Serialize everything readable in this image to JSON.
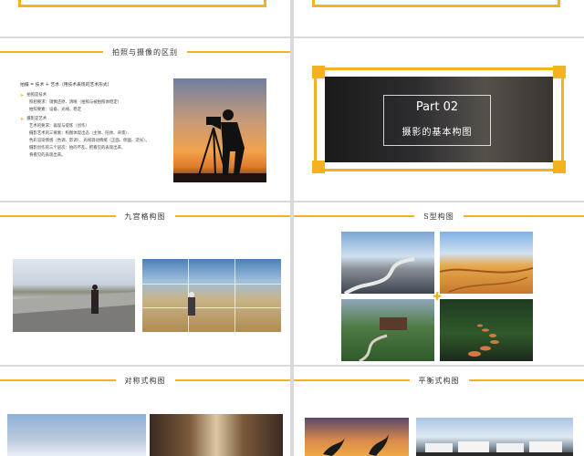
{
  "slides": {
    "distinction": {
      "title": "拍照与摄像的区别",
      "formula": "拍摄 = 技术 + 艺术（用技术表现的艺术形式）",
      "sections": [
        {
          "heading": "拍照是技术",
          "lines": [
            "照相要求：镜像还原、清晰（拍照与被拍照体稳定）",
            "拍照要素：设备、光线、稳定"
          ]
        },
        {
          "heading": "摄影是艺术",
          "lines": [
            "艺术的要求：再现与提炼（创作）",
            "摄影艺术的三要素：构图体现出态（主体、陪体、背景）、",
            "色彩渲染情感（色调、影调）、光线调动情绪（正面、侧面、逆光）。",
            "摄影创作的三个层次：拍的不乱、把看见的表现出来、",
            "将看见的表现出来。"
          ]
        }
      ]
    },
    "part": {
      "label": "Part 02",
      "subtitle": "摄影的基本构图"
    },
    "nine_grid": {
      "title": "九宫格构图"
    },
    "s_curve": {
      "title": "S型构图"
    },
    "symmetric": {
      "title": "对称式构图"
    },
    "balanced": {
      "title": "平衡式构图"
    }
  },
  "colors": {
    "accent": "#f5b21f",
    "slide_bg": "#ffffff",
    "page_bg": "#d9d9d9"
  }
}
